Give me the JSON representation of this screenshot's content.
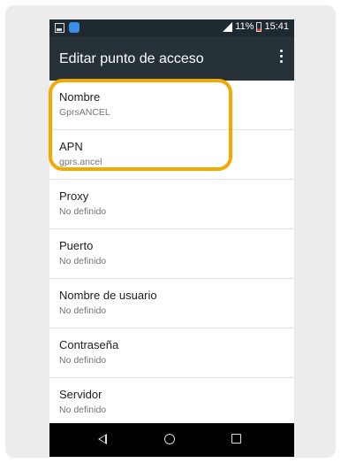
{
  "status_bar": {
    "battery_percent": "11%",
    "time": "15:41"
  },
  "app_bar": {
    "title": "Editar punto de acceso"
  },
  "settings": [
    {
      "label": "Nombre",
      "value": "GprsANCEL"
    },
    {
      "label": "APN",
      "value": "gprs.ancel"
    },
    {
      "label": "Proxy",
      "value": "No definido"
    },
    {
      "label": "Puerto",
      "value": "No definido"
    },
    {
      "label": "Nombre de usuario",
      "value": "No definido"
    },
    {
      "label": "Contraseña",
      "value": "No definido"
    },
    {
      "label": "Servidor",
      "value": "No definido"
    }
  ],
  "colors": {
    "highlight": "#f2a900",
    "app_bar": "#263238",
    "status_bar": "#1e2a30"
  }
}
